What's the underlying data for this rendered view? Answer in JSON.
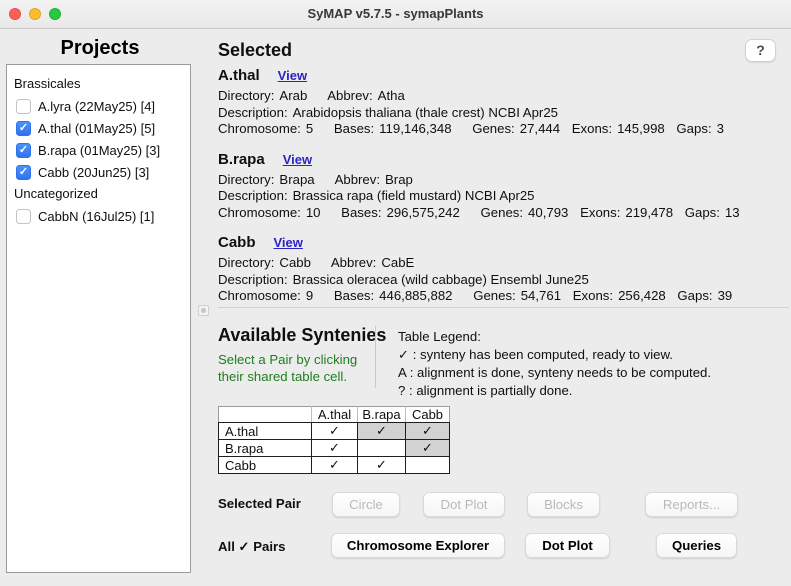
{
  "window": {
    "title": "SyMAP v5.7.5 - symapPlants"
  },
  "colors": {
    "traffic_red": "#ff5f57",
    "traffic_yellow": "#febc2e",
    "traffic_green": "#28c840",
    "checkbox_checked_blue": "#3478f6",
    "view_link_blue": "#2b24c4",
    "hint_green": "#1e7d1e",
    "table_shaded_gray": "#d2d2d2"
  },
  "projects": {
    "title": "Projects",
    "groups": [
      {
        "label": "Brassicales",
        "items": [
          {
            "label": "A.lyra (22May25) [4]",
            "checked": false
          },
          {
            "label": "A.thal (01May25) [5]",
            "checked": true
          },
          {
            "label": "B.rapa (01May25) [3]",
            "checked": true
          },
          {
            "label": "Cabb (20Jun25) [3]",
            "checked": true
          }
        ]
      },
      {
        "label": "Uncategorized",
        "items": [
          {
            "label": "CabbN (16Jul25) [1]",
            "checked": false
          }
        ]
      }
    ]
  },
  "labels": {
    "directory": "Directory:",
    "abbrev": "Abbrev:",
    "description": "Description:",
    "chromosome": "Chromosome:",
    "bases": "Bases:",
    "genes": "Genes:",
    "exons": "Exons:",
    "gaps": "Gaps:"
  },
  "selected": {
    "title": "Selected",
    "help_label": "?",
    "view_label": "View",
    "species": [
      {
        "name": "A.thal",
        "directory": "Arab",
        "abbrev": "Atha",
        "description": "Arabidopsis thaliana (thale crest) NCBI Apr25",
        "chromosome": "5",
        "bases": "119,146,348",
        "genes": "27,444",
        "exons": "145,998",
        "gaps": "3"
      },
      {
        "name": "B.rapa",
        "directory": "Brapa",
        "abbrev": "Brap",
        "description": "Brassica rapa (field mustard) NCBI Apr25",
        "chromosome": "10",
        "bases": "296,575,242",
        "genes": "40,793",
        "exons": "219,478",
        "gaps": "13"
      },
      {
        "name": "Cabb",
        "directory": "Cabb",
        "abbrev": "CabE",
        "description": "Brassica oleracea (wild cabbage) Ensembl June25",
        "chromosome": "9",
        "bases": "446,885,882",
        "genes": "54,761",
        "exons": "256,428",
        "gaps": "39"
      }
    ]
  },
  "syntenies": {
    "title": "Available Syntenies",
    "hint_lines": [
      "Select a Pair by clicking",
      "their shared table cell."
    ],
    "legend": {
      "title": "Table Legend:",
      "lines": [
        "✓ : synteny has been computed, ready to view.",
        "A : alignment is done, synteny needs to be computed.",
        "? : alignment is partially done."
      ]
    },
    "table": {
      "columns": [
        "A.thal",
        "B.rapa",
        "Cabb"
      ],
      "rows": [
        {
          "label": "A.thal",
          "cells": [
            "✓",
            "✓",
            "✓"
          ]
        },
        {
          "label": "B.rapa",
          "cells": [
            "✓",
            "",
            "✓"
          ]
        },
        {
          "label": "Cabb",
          "cells": [
            "✓",
            "✓",
            ""
          ]
        }
      ]
    }
  },
  "actions": {
    "selected_pair_label": "Selected Pair",
    "selected_pair_buttons": [
      "Circle",
      "Dot Plot",
      "Blocks",
      "Reports..."
    ],
    "all_pairs_label": "All ✓ Pairs",
    "all_pairs_buttons": [
      "Chromosome Explorer",
      "Dot Plot",
      "Queries"
    ]
  }
}
